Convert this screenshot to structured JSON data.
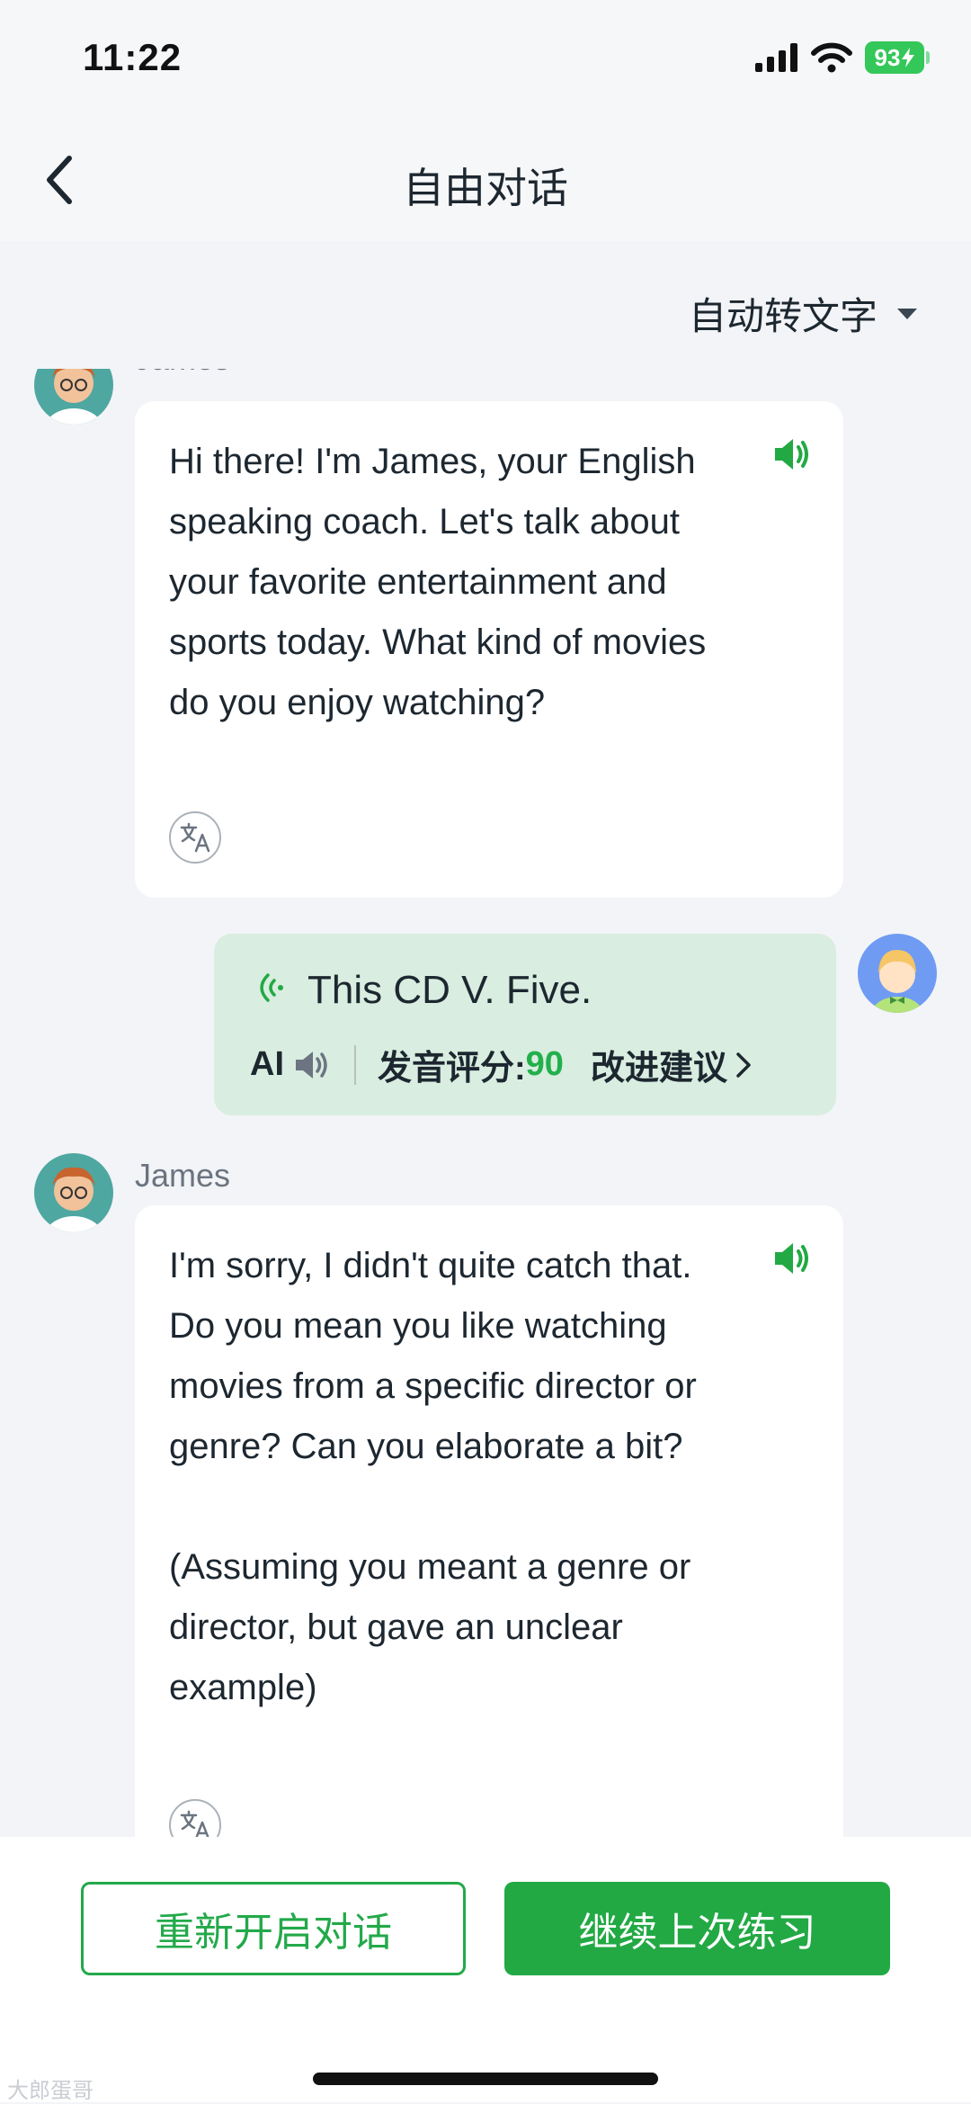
{
  "status_bar": {
    "time": "11:22",
    "battery": "93",
    "colors": {
      "battery": "#34c759"
    }
  },
  "nav": {
    "title": "自由对话",
    "back_icon": "chevron-left-icon"
  },
  "mode_toggle": {
    "label": "自动转文字"
  },
  "messages": [
    {
      "sender": "James",
      "role": "assistant",
      "text": "Hi there! I'm James, your English speaking coach. Let's talk about your favorite entertainment and sports today. What kind of movies do you enjoy watching?"
    },
    {
      "role": "user",
      "text": "This CD V. Five.",
      "ai_label": "AI",
      "score_label": "发音评分:",
      "score_value": "90",
      "suggest_label": "改进建议"
    },
    {
      "sender": "James",
      "role": "assistant",
      "text": "I'm sorry, I didn't quite catch that. Do you mean you like watching movies from a specific director or genre? Can you elaborate a bit?\n\n(Assuming you meant a genre or director, but gave an unclear example)"
    }
  ],
  "bottom_bar": {
    "restart_label": "重新开启对话",
    "continue_label": "继续上次练习"
  },
  "watermark": "大郎蛋哥",
  "colors": {
    "accent_green": "#22a944",
    "score_green": "#22b04c",
    "user_bubble": "#d9ede0",
    "background": "#f2f4f7"
  }
}
